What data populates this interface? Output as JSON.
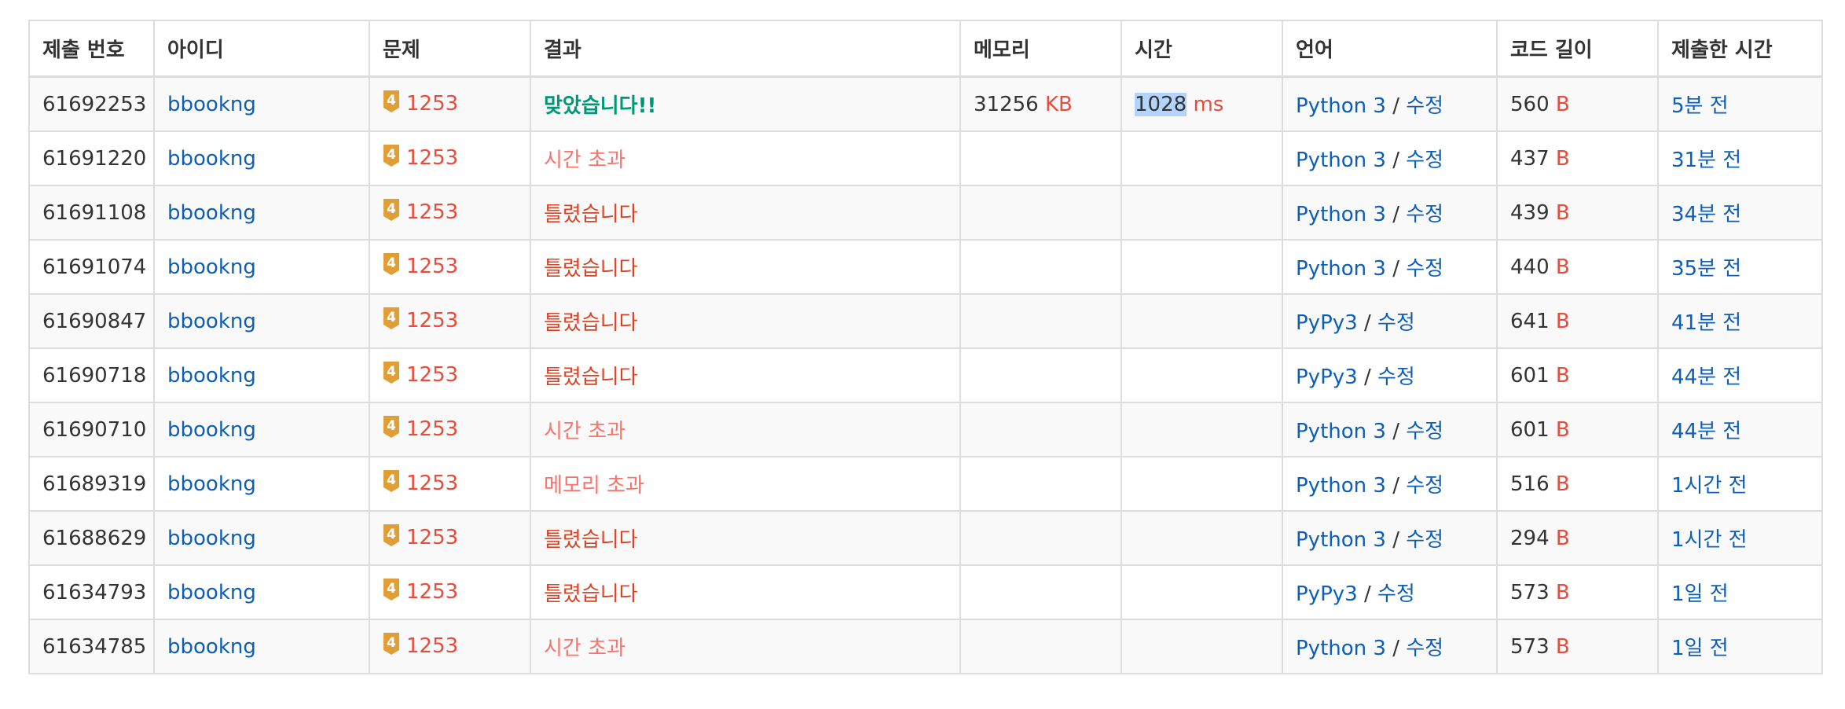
{
  "headers": [
    "제출 번호",
    "아이디",
    "문제",
    "결과",
    "메모리",
    "시간",
    "언어",
    "코드 길이",
    "제출한 시간"
  ],
  "tier_level": "4",
  "colors": {
    "link": "#0d5eb8",
    "accent_red": "#e74c3c",
    "correct": "#009874",
    "wrong": "#dd4124",
    "limit": "#fa7268",
    "tier_badge": "#e09e37",
    "selection": "#b3d4fc"
  },
  "rows": [
    {
      "id": "61692253",
      "user": "bbookng",
      "problem": "1253",
      "result": "맞았습니다!!",
      "result_type": "ac",
      "memory": "31256",
      "memory_unit": "KB",
      "time": "1028",
      "time_unit": "ms",
      "lang": "Python 3",
      "sep": " / ",
      "edit": "수정",
      "code_len": "560",
      "code_unit": "B",
      "submitted": "5분 전"
    },
    {
      "id": "61691220",
      "user": "bbookng",
      "problem": "1253",
      "result": "시간 초과",
      "result_type": "tle",
      "memory": "",
      "memory_unit": "",
      "time": "",
      "time_unit": "",
      "lang": "Python 3",
      "sep": " / ",
      "edit": "수정",
      "code_len": "437",
      "code_unit": "B",
      "submitted": "31분 전"
    },
    {
      "id": "61691108",
      "user": "bbookng",
      "problem": "1253",
      "result": "틀렸습니다",
      "result_type": "wa",
      "memory": "",
      "memory_unit": "",
      "time": "",
      "time_unit": "",
      "lang": "Python 3",
      "sep": " / ",
      "edit": "수정",
      "code_len": "439",
      "code_unit": "B",
      "submitted": "34분 전"
    },
    {
      "id": "61691074",
      "user": "bbookng",
      "problem": "1253",
      "result": "틀렸습니다",
      "result_type": "wa",
      "memory": "",
      "memory_unit": "",
      "time": "",
      "time_unit": "",
      "lang": "Python 3",
      "sep": " / ",
      "edit": "수정",
      "code_len": "440",
      "code_unit": "B",
      "submitted": "35분 전"
    },
    {
      "id": "61690847",
      "user": "bbookng",
      "problem": "1253",
      "result": "틀렸습니다",
      "result_type": "wa",
      "memory": "",
      "memory_unit": "",
      "time": "",
      "time_unit": "",
      "lang": "PyPy3",
      "sep": " / ",
      "edit": "수정",
      "code_len": "641",
      "code_unit": "B",
      "submitted": "41분 전"
    },
    {
      "id": "61690718",
      "user": "bbookng",
      "problem": "1253",
      "result": "틀렸습니다",
      "result_type": "wa",
      "memory": "",
      "memory_unit": "",
      "time": "",
      "time_unit": "",
      "lang": "PyPy3",
      "sep": " / ",
      "edit": "수정",
      "code_len": "601",
      "code_unit": "B",
      "submitted": "44분 전"
    },
    {
      "id": "61690710",
      "user": "bbookng",
      "problem": "1253",
      "result": "시간 초과",
      "result_type": "tle",
      "memory": "",
      "memory_unit": "",
      "time": "",
      "time_unit": "",
      "lang": "Python 3",
      "sep": " / ",
      "edit": "수정",
      "code_len": "601",
      "code_unit": "B",
      "submitted": "44분 전"
    },
    {
      "id": "61689319",
      "user": "bbookng",
      "problem": "1253",
      "result": "메모리 초과",
      "result_type": "mle",
      "memory": "",
      "memory_unit": "",
      "time": "",
      "time_unit": "",
      "lang": "Python 3",
      "sep": " / ",
      "edit": "수정",
      "code_len": "516",
      "code_unit": "B",
      "submitted": "1시간 전"
    },
    {
      "id": "61688629",
      "user": "bbookng",
      "problem": "1253",
      "result": "틀렸습니다",
      "result_type": "wa",
      "memory": "",
      "memory_unit": "",
      "time": "",
      "time_unit": "",
      "lang": "Python 3",
      "sep": " / ",
      "edit": "수정",
      "code_len": "294",
      "code_unit": "B",
      "submitted": "1시간 전"
    },
    {
      "id": "61634793",
      "user": "bbookng",
      "problem": "1253",
      "result": "틀렸습니다",
      "result_type": "wa",
      "memory": "",
      "memory_unit": "",
      "time": "",
      "time_unit": "",
      "lang": "PyPy3",
      "sep": " / ",
      "edit": "수정",
      "code_len": "573",
      "code_unit": "B",
      "submitted": "1일 전"
    },
    {
      "id": "61634785",
      "user": "bbookng",
      "problem": "1253",
      "result": "시간 초과",
      "result_type": "tle",
      "memory": "",
      "memory_unit": "",
      "time": "",
      "time_unit": "",
      "lang": "Python 3",
      "sep": " / ",
      "edit": "수정",
      "code_len": "573",
      "code_unit": "B",
      "submitted": "1일 전"
    }
  ]
}
